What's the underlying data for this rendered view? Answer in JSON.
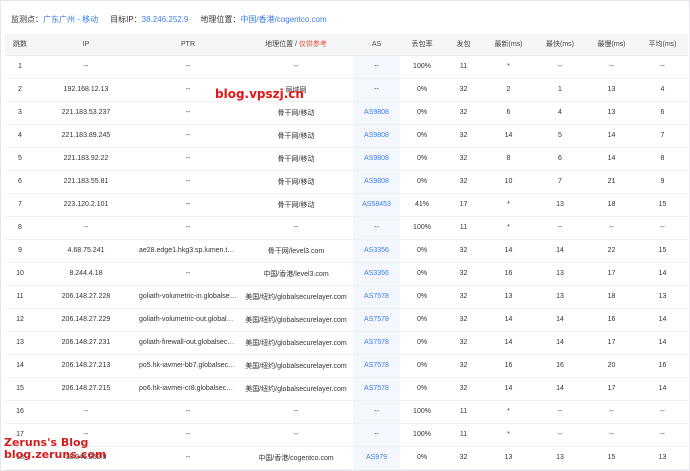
{
  "header": {
    "probe_label": "监测点：",
    "probe_value": "广东广州 - 移动",
    "target_label": "目标IP：",
    "target_value": "38.246.252.9",
    "geo_label": "地理位置：",
    "geo_value": "中国/香港/cogentco.com"
  },
  "columns": {
    "hop": "跳数",
    "ip": "IP",
    "ptr": "PTR",
    "geo": "地理位置",
    "geo_sep": " / ",
    "geo_hint": "仅供参考",
    "as": "AS",
    "loss": "丢包率",
    "sent": "发包",
    "last": "最新(ms)",
    "best": "最快(ms)",
    "worst": "最慢(ms)",
    "avg": "平均(ms)"
  },
  "rows": [
    {
      "hop": "1",
      "ip": "--",
      "ptr": "--",
      "geo": "--",
      "as": "--",
      "loss": "100%",
      "sent": "11",
      "last": "*",
      "best": "--",
      "worst": "--",
      "avg": "--"
    },
    {
      "hop": "2",
      "ip": "192.168.12.13",
      "ptr": "--",
      "geo": "局域网",
      "as": "--",
      "loss": "0%",
      "sent": "32",
      "last": "2",
      "best": "1",
      "worst": "13",
      "avg": "4"
    },
    {
      "hop": "3",
      "ip": "221.183.53.237",
      "ptr": "--",
      "geo": "骨干网/移动",
      "as": "AS9808",
      "loss": "0%",
      "sent": "32",
      "last": "6",
      "best": "4",
      "worst": "13",
      "avg": "6"
    },
    {
      "hop": "4",
      "ip": "221.183.89.245",
      "ptr": "--",
      "geo": "骨干网/移动",
      "as": "AS9808",
      "loss": "0%",
      "sent": "32",
      "last": "14",
      "best": "5",
      "worst": "14",
      "avg": "7"
    },
    {
      "hop": "5",
      "ip": "221.183.92.22",
      "ptr": "--",
      "geo": "骨干网/移动",
      "as": "AS9808",
      "loss": "0%",
      "sent": "32",
      "last": "8",
      "best": "6",
      "worst": "14",
      "avg": "8"
    },
    {
      "hop": "6",
      "ip": "221.183.55.81",
      "ptr": "--",
      "geo": "骨干网/移动",
      "as": "AS9808",
      "loss": "0%",
      "sent": "32",
      "last": "10",
      "best": "7",
      "worst": "21",
      "avg": "9"
    },
    {
      "hop": "7",
      "ip": "223.120.2.101",
      "ptr": "--",
      "geo": "骨干网/移动",
      "as": "AS58453",
      "loss": "41%",
      "sent": "17",
      "last": "*",
      "best": "13",
      "worst": "18",
      "avg": "15"
    },
    {
      "hop": "8",
      "ip": "--",
      "ptr": "--",
      "geo": "--",
      "as": "--",
      "loss": "100%",
      "sent": "11",
      "last": "*",
      "best": "--",
      "worst": "--",
      "avg": "--"
    },
    {
      "hop": "9",
      "ip": "4.68.75.241",
      "ptr": "ae28.edge1.hkg3.sp.lumen.tech",
      "geo": "骨干网/level3.com",
      "as": "AS3356",
      "loss": "0%",
      "sent": "32",
      "last": "14",
      "best": "14",
      "worst": "22",
      "avg": "15"
    },
    {
      "hop": "10",
      "ip": "8.244.4.18",
      "ptr": "--",
      "geo": "中国/香港/level3.com",
      "as": "AS3356",
      "loss": "0%",
      "sent": "32",
      "last": "16",
      "best": "13",
      "worst": "17",
      "avg": "14"
    },
    {
      "hop": "11",
      "ip": "206.148.27.228",
      "ptr": "goliath-volumetric-in.globalsecurelayer.com",
      "geo": "美国/纽约/globalsecurelayer.com",
      "as": "AS7578",
      "loss": "0%",
      "sent": "32",
      "last": "13",
      "best": "13",
      "worst": "18",
      "avg": "13"
    },
    {
      "hop": "12",
      "ip": "206.148.27.229",
      "ptr": "goliath-volumetric-out.globalsecurelayer.com",
      "geo": "美国/纽约/globalsecurelayer.com",
      "as": "AS7578",
      "loss": "0%",
      "sent": "32",
      "last": "14",
      "best": "14",
      "worst": "16",
      "avg": "14"
    },
    {
      "hop": "13",
      "ip": "206.148.27.231",
      "ptr": "goliath-firewall-out.globalsecurelayer.com",
      "geo": "美国/纽约/globalsecurelayer.com",
      "as": "AS7578",
      "loss": "0%",
      "sent": "32",
      "last": "14",
      "best": "14",
      "worst": "17",
      "avg": "14"
    },
    {
      "hop": "14",
      "ip": "206.148.27.213",
      "ptr": "po5.hk-iavmei-bb7.globalsecurelayer.com",
      "geo": "美国/纽约/globalsecurelayer.com",
      "as": "AS7578",
      "loss": "0%",
      "sent": "32",
      "last": "16",
      "best": "16",
      "worst": "20",
      "avg": "16"
    },
    {
      "hop": "15",
      "ip": "206.148.27.215",
      "ptr": "po6.hk-iavmei-cr8.globalsecurelayer.com",
      "geo": "美国/纽约/globalsecurelayer.com",
      "as": "AS7578",
      "loss": "0%",
      "sent": "32",
      "last": "14",
      "best": "14",
      "worst": "17",
      "avg": "14"
    },
    {
      "hop": "16",
      "ip": "--",
      "ptr": "--",
      "geo": "--",
      "as": "--",
      "loss": "100%",
      "sent": "11",
      "last": "*",
      "best": "--",
      "worst": "--",
      "avg": "--"
    },
    {
      "hop": "17",
      "ip": "--",
      "ptr": "--",
      "geo": "--",
      "as": "--",
      "loss": "100%",
      "sent": "11",
      "last": "*",
      "best": "--",
      "worst": "--",
      "avg": "--"
    },
    {
      "hop": "18",
      "ip": "38.246.252.9",
      "ptr": "--",
      "geo": "中国/香港/cogentco.com",
      "as": "AS979",
      "loss": "0%",
      "sent": "32",
      "last": "13",
      "best": "13",
      "worst": "15",
      "avg": "13"
    }
  ],
  "watermarks": {
    "center": "blog.vpszj.cn",
    "corner_line1": "Zeruns's Blog",
    "corner_line2": "blog.zeruns.com"
  },
  "colors": {
    "accent": "#3a7ee6",
    "hint": "#e94b35",
    "header_bg": "#f5f6f8",
    "as_cell_bg": "#f4f7fd"
  }
}
